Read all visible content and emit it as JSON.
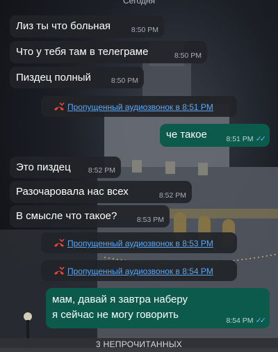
{
  "date_label": "Сегодня",
  "messages": [
    {
      "text": "Лиз ты что больная",
      "time": "8:50 PM"
    },
    {
      "text": "Что у тебя там в телеграме",
      "time": "8:50 PM"
    },
    {
      "text": "Пиздец полный",
      "time": "8:50 PM"
    },
    {
      "text": "Пропущенный аудиозвонок в 8:51 PM"
    },
    {
      "text": "че такое",
      "time": "8:51 PM"
    },
    {
      "text": "Это пиздец",
      "time": "8:52 PM"
    },
    {
      "text": "Разочаровала нас всех",
      "time": "8:52 PM"
    },
    {
      "text": "В смысле что такое?",
      "time": "8:53 PM"
    },
    {
      "text": "Пропущенный аудиозвонок в 8:53 PM"
    },
    {
      "text": "Пропущенный аудиозвонок в 8:54 PM"
    },
    {
      "line1": "мам, давай я завтра наберу",
      "line2": "я сейчас не могу говорить",
      "time": "8:54 PM"
    }
  ],
  "unread_label": "3 НЕПРОЧИТАННЫХ",
  "colors": {
    "incoming": "#212328",
    "outgoing": "#0b5a4c",
    "link": "#5da7f2",
    "missed_call": "#e5453b",
    "read_ticks": "#5fb8f5"
  }
}
